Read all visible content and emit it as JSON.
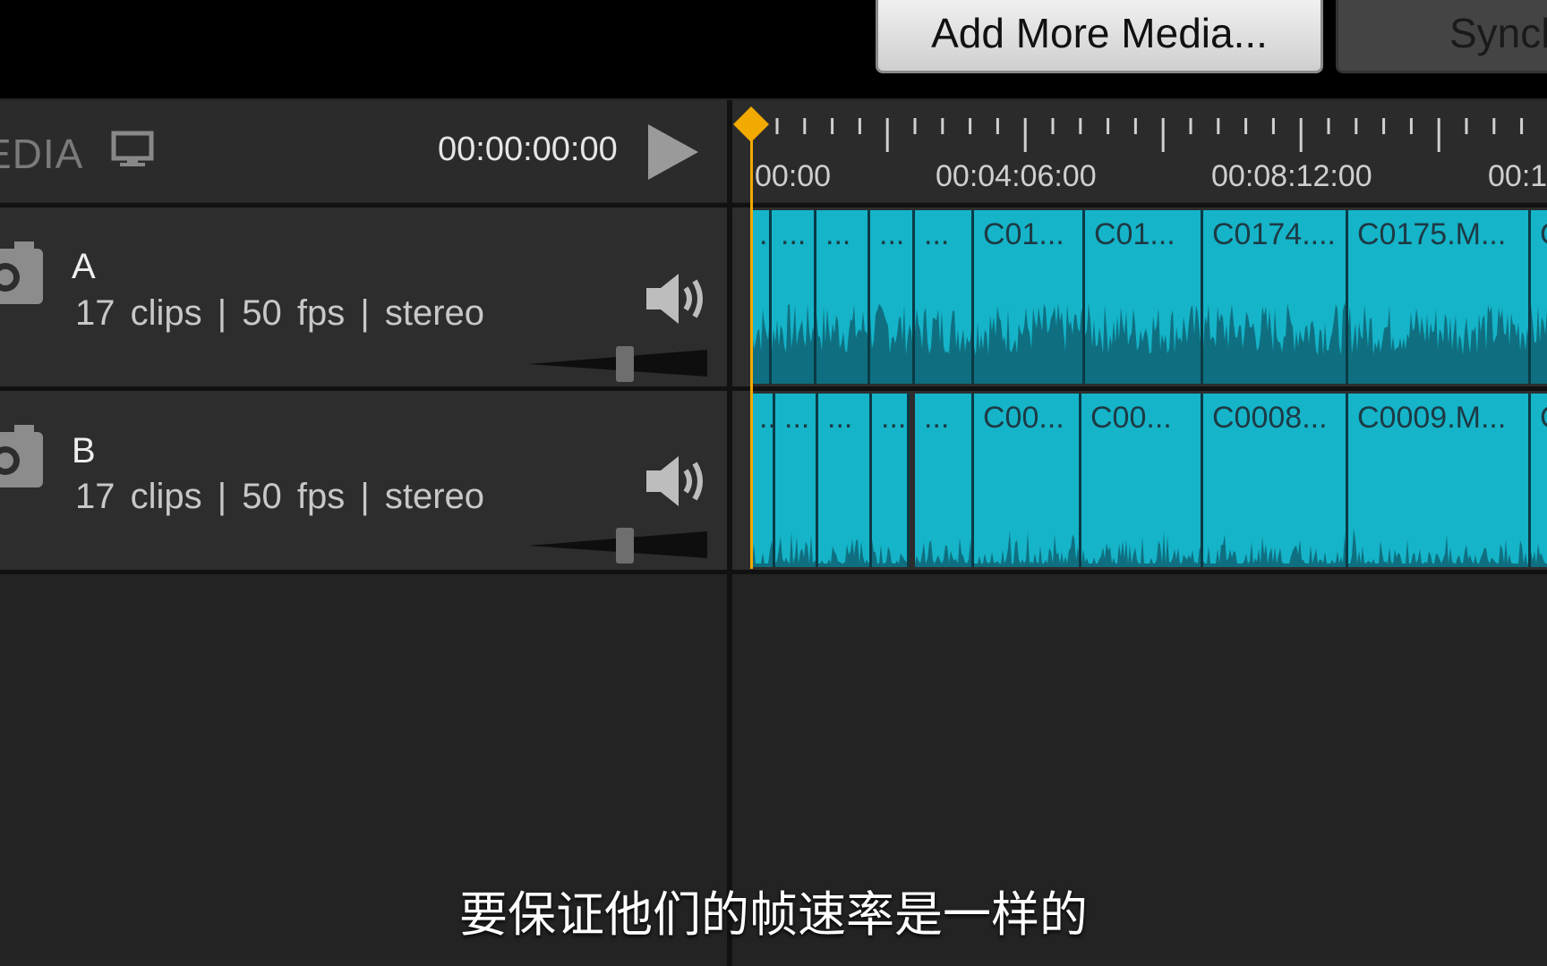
{
  "toolbar": {
    "add_media_label": "Add More Media...",
    "sync_label": "Synch"
  },
  "header": {
    "media_label": "EDIA",
    "timecode": "00:00:00:00"
  },
  "ruler": {
    "labels": [
      "00:00",
      "00:04:06:00",
      "00:08:12:00",
      "00:1"
    ]
  },
  "tracks": [
    {
      "name": "A",
      "clips": "17 clips",
      "fps": "50 fps",
      "audio": "stereo",
      "separator": "|",
      "clip_labels": [
        "...",
        "...",
        "...",
        "...",
        "...",
        "C01...",
        "C01...",
        "C0174....",
        "C0175.M...",
        "C"
      ]
    },
    {
      "name": "B",
      "clips": "17 clips",
      "fps": "50 fps",
      "audio": "stereo",
      "separator": "|",
      "clip_labels": [
        "...",
        "...",
        "...",
        "...",
        "...",
        "C00...",
        "C00...",
        "C0008...",
        "C0009.M...",
        "C"
      ]
    }
  ],
  "subtitle": "要保证他们的帧速率是一样的",
  "colors": {
    "clip": "#15b4c9",
    "playhead": "#f2a900",
    "background": "#232323"
  }
}
